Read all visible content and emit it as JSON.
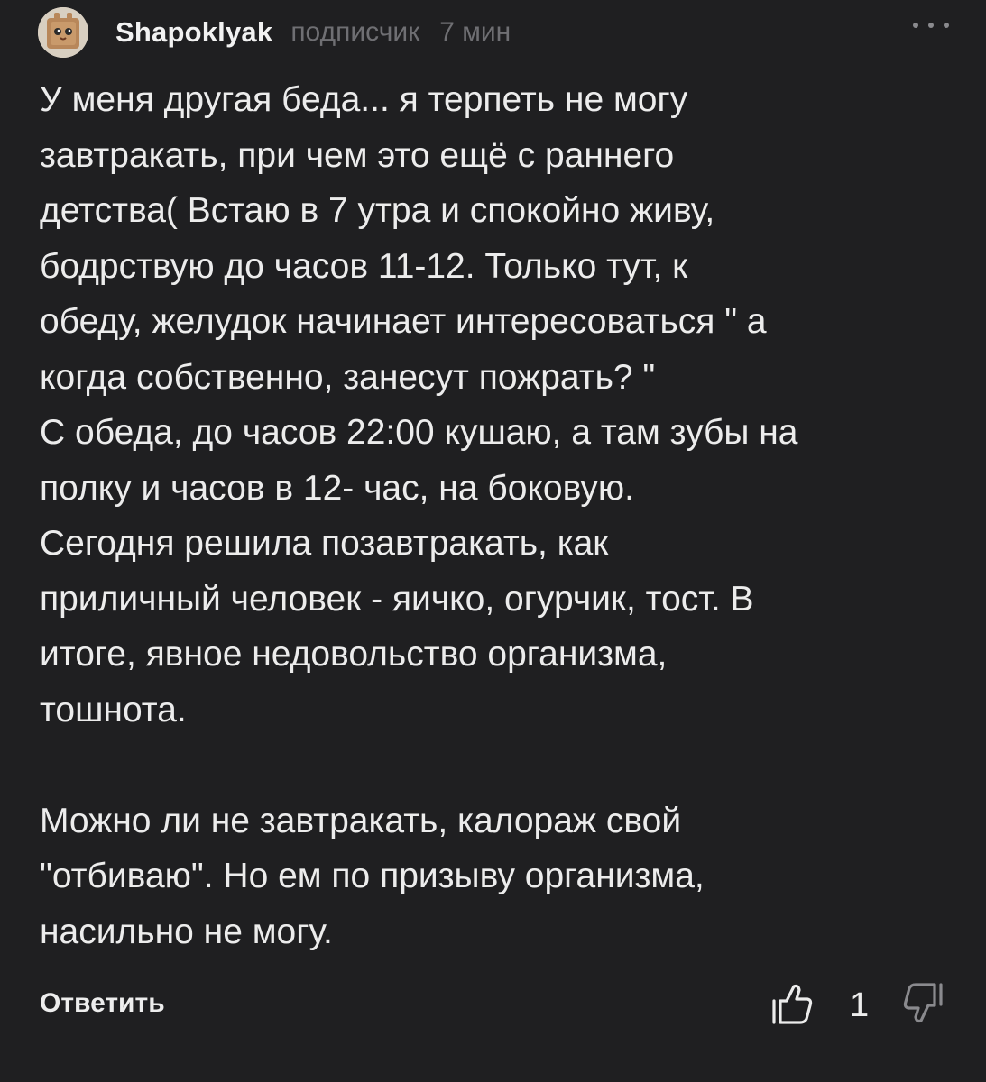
{
  "comment": {
    "author": "Shapoklyak",
    "role": "подписчик",
    "time": "7 мин",
    "text": "У меня другая беда... я терпеть не могу\nзавтракать, при чем это ещё с раннего\nдетства( Встаю в 7 утра и спокойно живу,\nбодрствую до часов 11-12. Только тут, к\nобеду, желудок начинает интересоваться \" а\nкогда собственно, занесут пожрать? \"\nС обеда, до часов 22:00 кушаю, а там зубы на\nполку и часов в 12- час, на боковую.\nСегодня решила позавтракать, как\nприличный человек - яичко, огурчик, тост. В\nитоге, явное недовольство организма,\nтошнота.\n\nМожно ли не завтракать, калораж свой\n\"отбиваю\". Но ем по призыву организма,\nнасильно не могу.",
    "reply_label": "Ответить",
    "like_count": "1",
    "icons": {
      "more": "more-dots-icon",
      "like": "thumb-up-icon",
      "dislike": "thumb-down-icon"
    }
  }
}
